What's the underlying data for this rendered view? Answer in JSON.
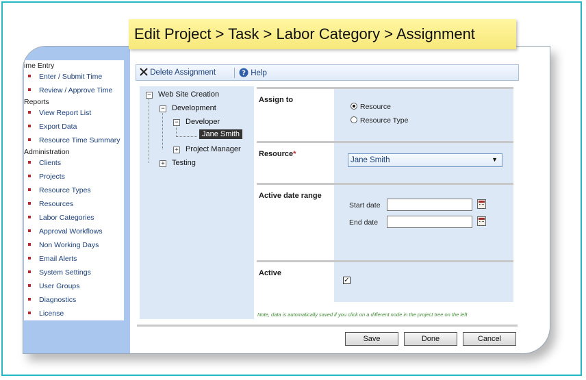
{
  "title": "Edit Project > Task > Labor Category > Assignment",
  "sidebar": {
    "sections": [
      {
        "label": "ime Entry",
        "items": [
          "Enter / Submit Time",
          "Review / Approve Time"
        ]
      },
      {
        "label": "Reports",
        "items": [
          "View Report List",
          "Export Data",
          "Resource Time Summary"
        ]
      },
      {
        "label": "Administration",
        "items": [
          "Clients",
          "Projects",
          "Resource Types",
          "Resources",
          "Labor Categories",
          "Approval Workflows",
          "Non Working Days",
          "Email Alerts",
          "System Settings",
          "User Groups",
          "Diagnostics",
          "License"
        ]
      }
    ]
  },
  "toolbar": {
    "delete_label": "Delete Assignment",
    "help_label": "Help"
  },
  "tree": {
    "root": "Web Site Creation",
    "development": "Development",
    "developer": "Developer",
    "selected": "Jane Smith",
    "project_manager": "Project Manager",
    "testing": "Testing"
  },
  "form": {
    "assign_to": {
      "label": "Assign to",
      "options": [
        "Resource",
        "Resource Type"
      ],
      "selected": "Resource"
    },
    "resource": {
      "label": "Resource",
      "required_mark": "*",
      "value": "Jane Smith"
    },
    "date_range": {
      "label": "Active date range",
      "start_label": "Start date",
      "end_label": "End date",
      "start_value": "",
      "end_value": ""
    },
    "active": {
      "label": "Active",
      "checked": true
    }
  },
  "note": "Note, data is automatically saved if you click on a different node in the project tree on the left",
  "buttons": {
    "save": "Save",
    "done": "Done",
    "cancel": "Cancel"
  },
  "colors": {
    "accent": "#26b7c4",
    "banner": "#f7e87a",
    "panel": "#dde8f6",
    "bullet": "#c0242b",
    "note": "#3f8a34"
  }
}
